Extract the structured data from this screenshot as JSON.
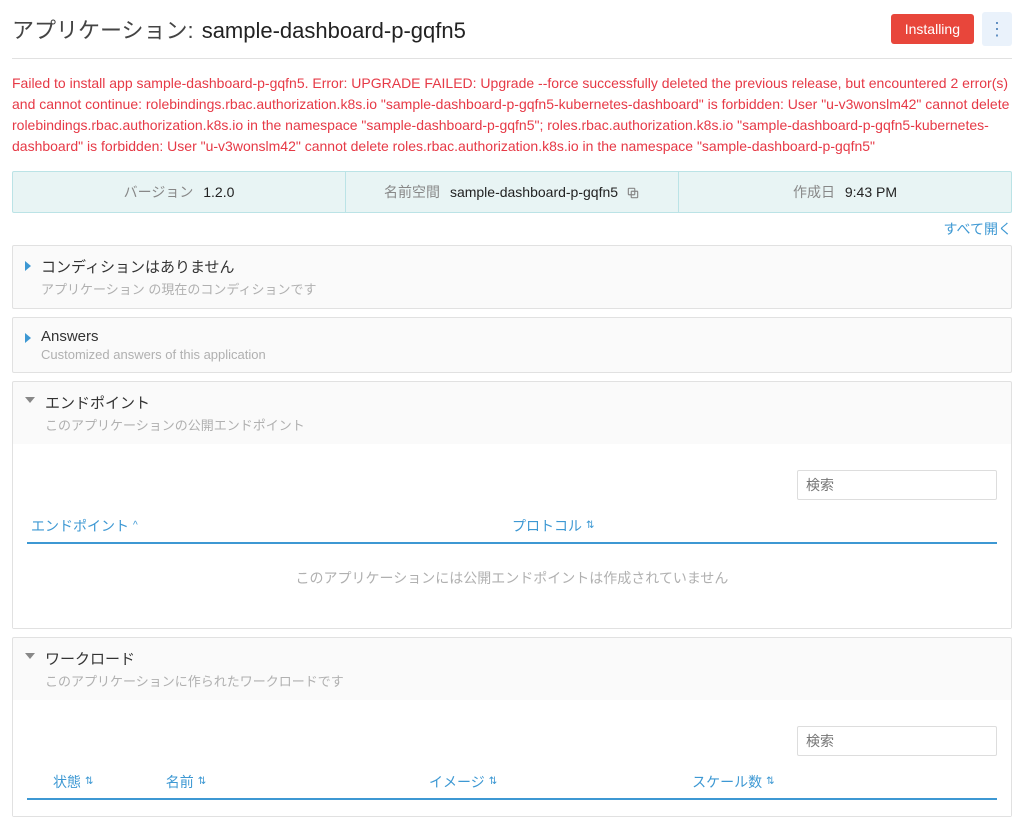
{
  "header": {
    "title_prefix": "アプリケーション:",
    "title_name": "sample-dashboard-p-gqfn5",
    "status_badge": "Installing",
    "kebab_glyph": "⋮"
  },
  "error_text": "Failed to install app sample-dashboard-p-gqfn5. Error: UPGRADE FAILED: Upgrade --force successfully deleted the previous release, but encountered 2 error(s) and cannot continue: rolebindings.rbac.authorization.k8s.io \"sample-dashboard-p-gqfn5-kubernetes-dashboard\" is forbidden: User \"u-v3wonslm42\" cannot delete rolebindings.rbac.authorization.k8s.io in the namespace \"sample-dashboard-p-gqfn5\"; roles.rbac.authorization.k8s.io \"sample-dashboard-p-gqfn5-kubernetes-dashboard\" is forbidden: User \"u-v3wonslm42\" cannot delete roles.rbac.authorization.k8s.io in the namespace \"sample-dashboard-p-gqfn5\"",
  "info": {
    "version_label": "バージョン",
    "version_value": "1.2.0",
    "namespace_label": "名前空間",
    "namespace_value": "sample-dashboard-p-gqfn5",
    "created_label": "作成日",
    "created_value": "9:43 PM"
  },
  "expand_all": "すべて開く",
  "panels": {
    "conditions": {
      "title": "コンディションはありません",
      "sub": "アプリケーション の現在のコンディションです"
    },
    "answers": {
      "title": "Answers",
      "sub": "Customized answers of this application"
    },
    "endpoints": {
      "title": "エンドポイント",
      "sub": "このアプリケーションの公開エンドポイント",
      "search_placeholder": "検索",
      "col_endpoint": "エンドポイント",
      "col_protocol": "プロトコル",
      "empty": "このアプリケーションには公開エンドポイントは作成されていません"
    },
    "workloads": {
      "title": "ワークロード",
      "sub": "このアプリケーションに作られたワークロードです",
      "search_placeholder": "検索",
      "col_state": "状態",
      "col_name": "名前",
      "col_image": "イメージ",
      "col_scale": "スケール数"
    }
  },
  "glyphs": {
    "sort": "⇅",
    "sort_asc_marker": "^"
  }
}
